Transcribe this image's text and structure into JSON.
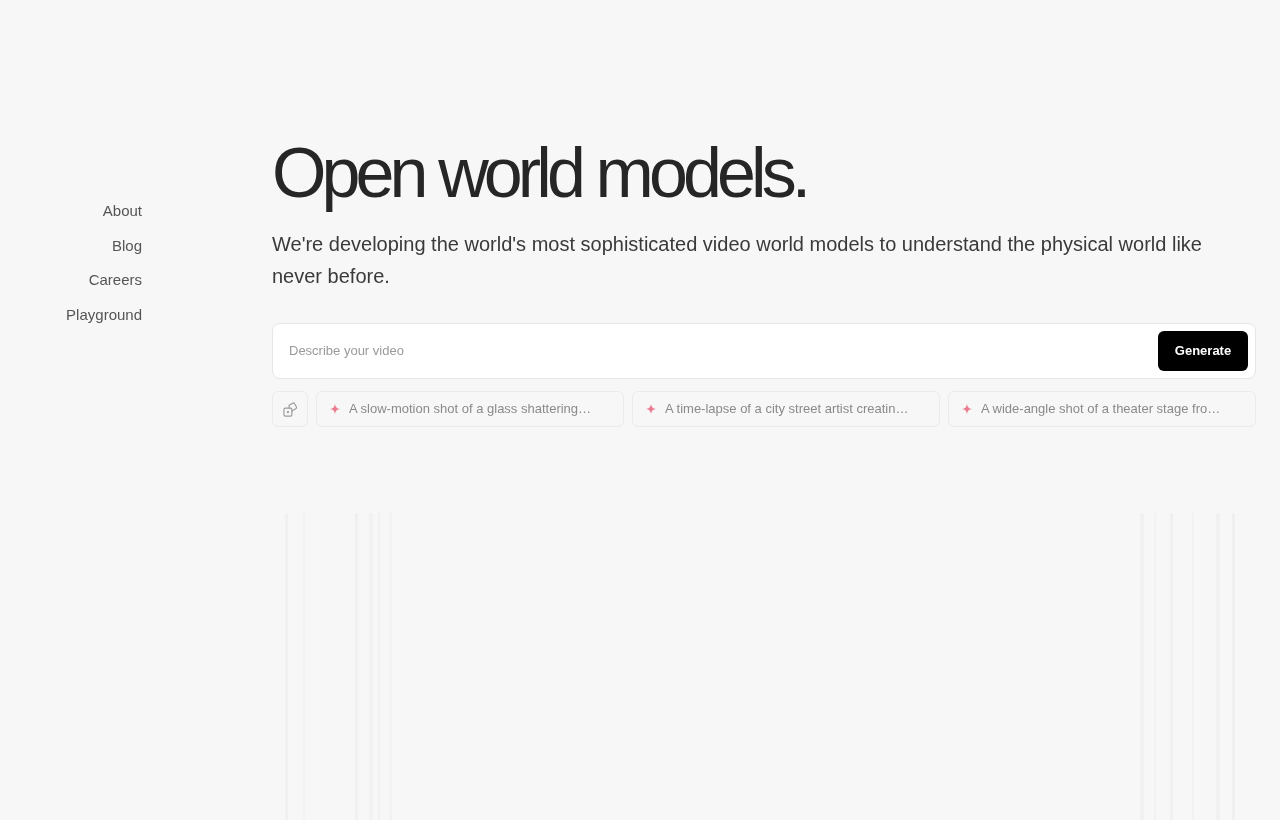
{
  "nav": [
    "About",
    "Blog",
    "Careers",
    "Playground"
  ],
  "hero": {
    "title": "Open world models.",
    "subtitle": "We're developing the world's most sophisticated video world models to understand the physical world like never before."
  },
  "prompt": {
    "placeholder": "Describe your video",
    "button": "Generate"
  },
  "suggestions": [
    "A slow-motion shot of a glass shattering…",
    "A time-lapse of a city street artist creatin…",
    "A wide-angle shot of a theater stage fro…"
  ]
}
